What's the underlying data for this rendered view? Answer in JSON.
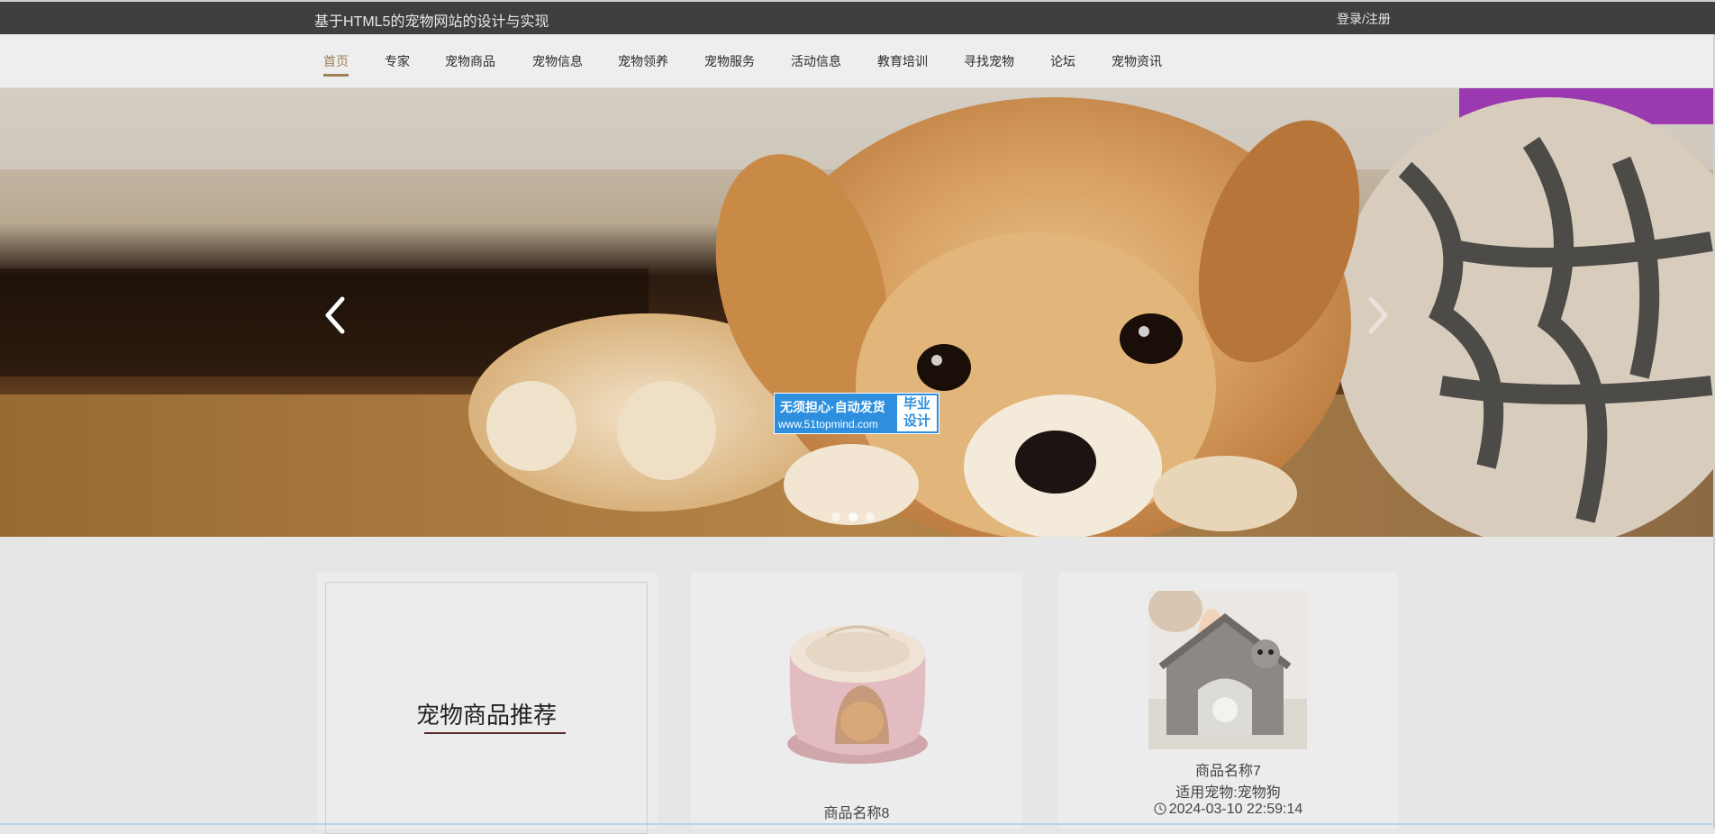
{
  "header": {
    "site_title": "基于HTML5的宠物网站的设计与实现",
    "login_label": "登录/注册"
  },
  "nav": {
    "items": [
      {
        "label": "首页",
        "active": true
      },
      {
        "label": "专家"
      },
      {
        "label": "宠物商品"
      },
      {
        "label": "宠物信息"
      },
      {
        "label": "宠物领养"
      },
      {
        "label": "宠物服务"
      },
      {
        "label": "活动信息"
      },
      {
        "label": "教育培训"
      },
      {
        "label": "寻找宠物"
      },
      {
        "label": "论坛"
      },
      {
        "label": "宠物资讯"
      }
    ]
  },
  "banner": {
    "image": "puppy lying on floor",
    "slides": 3,
    "active_slide": 1,
    "prev_icon": "chevron-left-icon",
    "next_icon": "chevron-right-icon"
  },
  "watermark": {
    "line1": "无须担心·自动发货",
    "line2": "www.51topmind.com",
    "box_line1": "毕业",
    "box_line2": "设计"
  },
  "recommend": {
    "title": "宠物商品推荐"
  },
  "products": [
    {
      "name": "商品名称8",
      "image": "pink pet bed"
    },
    {
      "name": "商品名称7",
      "suitable": "适用宠物:宠物狗",
      "time": "2024-03-10 22:59:14",
      "image": "grey pet house"
    }
  ],
  "colors": {
    "topbar": "#3f3f3f",
    "nav_active": "#a08055",
    "watermark_blue": "#2e8fde"
  }
}
